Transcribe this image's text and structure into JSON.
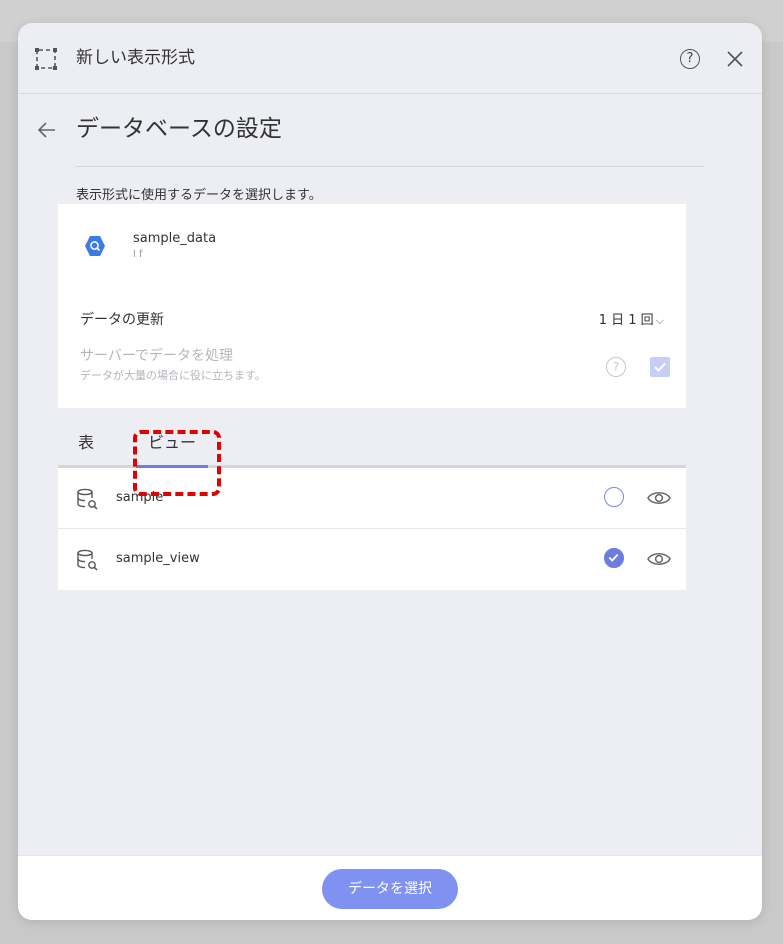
{
  "dialog": {
    "title": "新しい表示形式",
    "help_glyph": "?"
  },
  "page": {
    "title": "データベースの設定",
    "description": "表示形式に使用するデータを選択します。"
  },
  "source": {
    "name": "sample_data",
    "sub": "l f",
    "icon": "bigquery-icon",
    "icon_color": "#3b7be8"
  },
  "settings": {
    "refresh_label": "データの更新",
    "refresh_value": "1 日 1 回",
    "server_label": "サーバーでデータを処理",
    "server_sub": "データが大量の場合に役に立ちます。",
    "server_help_glyph": "?",
    "server_checked": true
  },
  "tabs": [
    {
      "label": "表",
      "active": false
    },
    {
      "label": "ビュー",
      "active": true
    }
  ],
  "items": [
    {
      "label": "sample",
      "selected": false,
      "icon": "database-search-icon"
    },
    {
      "label": "sample_view",
      "selected": true,
      "icon": "database-search-icon"
    }
  ],
  "footer": {
    "select_label": "データを選択"
  },
  "colors": {
    "accent": "#6c7ce0",
    "button": "#7f92f2",
    "highlight": "#e00000"
  }
}
